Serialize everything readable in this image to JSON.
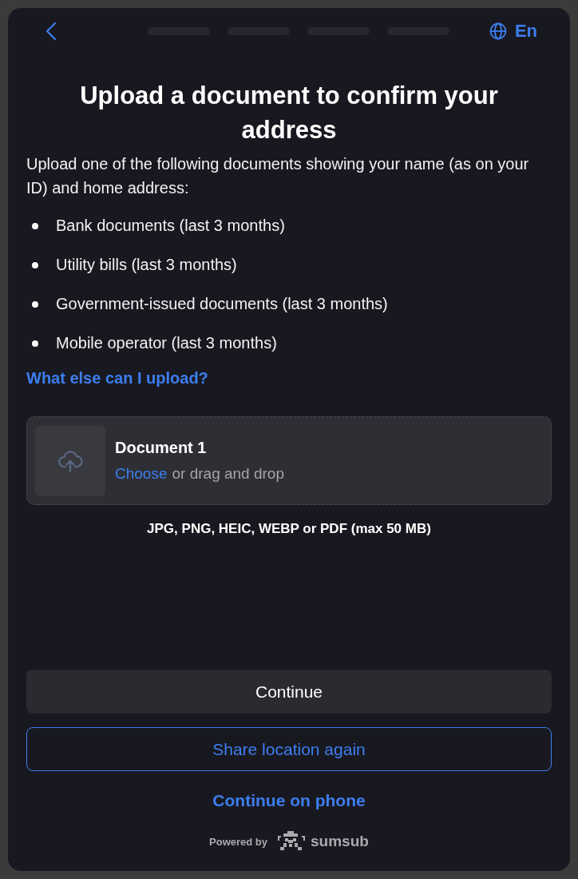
{
  "header": {
    "steps": [
      {
        "done": false
      },
      {
        "done": false
      },
      {
        "done": false
      },
      {
        "done": false
      }
    ],
    "language": "En"
  },
  "title": "Upload a document to confirm your address",
  "intro": "Upload one of the following documents showing your name (as on your ID) and home address:",
  "documents": [
    "Bank documents (last 3 months)",
    "Utility bills (last 3 months)",
    "Government-issued documents (last 3 months)",
    "Mobile operator (last 3 months)"
  ],
  "help_link": "What else can I upload?",
  "upload": {
    "title": "Document 1",
    "choose_link": "Choose",
    "hint": "or drag and drop",
    "formats": "JPG, PNG, HEIC, WEBP or PDF (max 50 MB)"
  },
  "buttons": [
    {
      "label": "Continue",
      "kind": "filled"
    },
    {
      "label": "Share location again",
      "kind": "outlined"
    },
    {
      "label": "Continue on phone",
      "kind": "text"
    }
  ],
  "footer": {
    "powered_by": "Powered by",
    "brand": "sumsub"
  }
}
